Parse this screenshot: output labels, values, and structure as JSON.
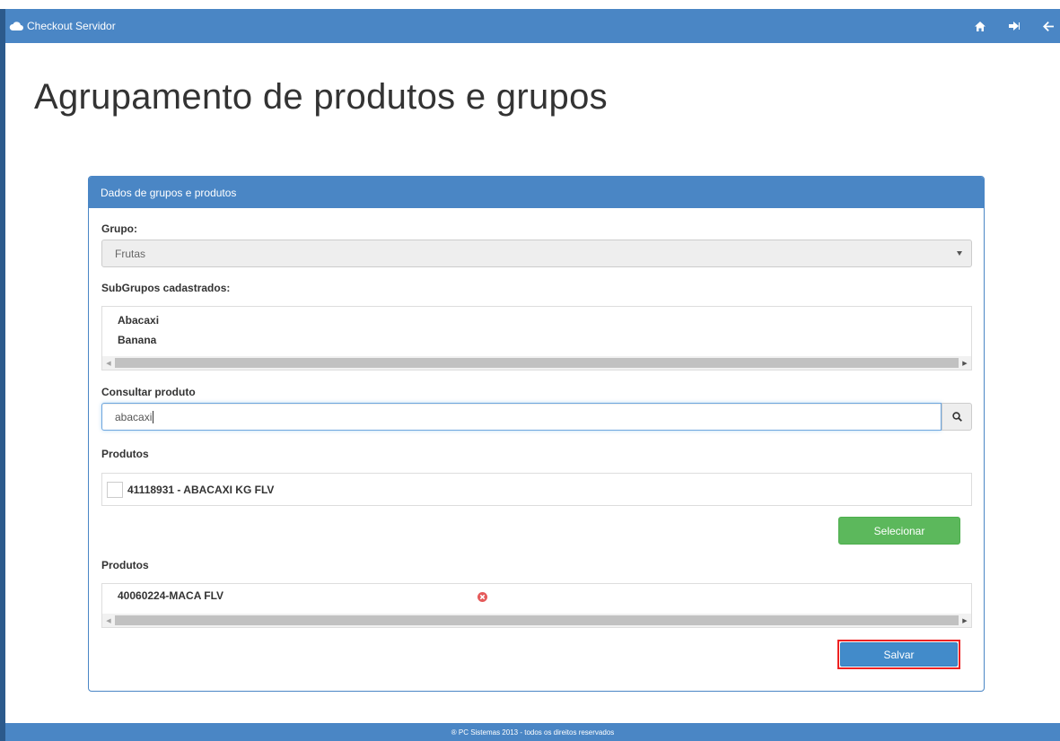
{
  "app": {
    "title": "Checkout Servidor",
    "nav_icons": [
      "home-icon",
      "sign-out-icon",
      "back-arrow-icon"
    ]
  },
  "page": {
    "title": "Agrupamento de produtos e grupos"
  },
  "panel": {
    "heading": "Dados de grupos e produtos",
    "grupo_label": "Grupo:",
    "grupo_value": "Frutas",
    "subgrupos_label": "SubGrupos cadastrados:",
    "subgrupos": [
      {
        "label": "Abacaxi"
      },
      {
        "label": "Banana"
      }
    ],
    "consultar_label": "Consultar produto",
    "search_value": "abacaxi",
    "produtos_label": "Produtos",
    "produtos": [
      {
        "label": "41118931 - ABACAXI KG FLV",
        "checked": false
      }
    ],
    "selecionar_label": "Selecionar",
    "selecionados_label": "Produtos",
    "selecionados": [
      {
        "label": "40060224-MACA FLV"
      }
    ],
    "salvar_label": "Salvar"
  },
  "footer": {
    "text": "® PC Sistemas 2013 - todos os direitos reservados"
  },
  "colors": {
    "primary": "#4a86c5",
    "success": "#5cb85c",
    "danger": "#e55a5a",
    "highlight_border": "#ee2222"
  }
}
